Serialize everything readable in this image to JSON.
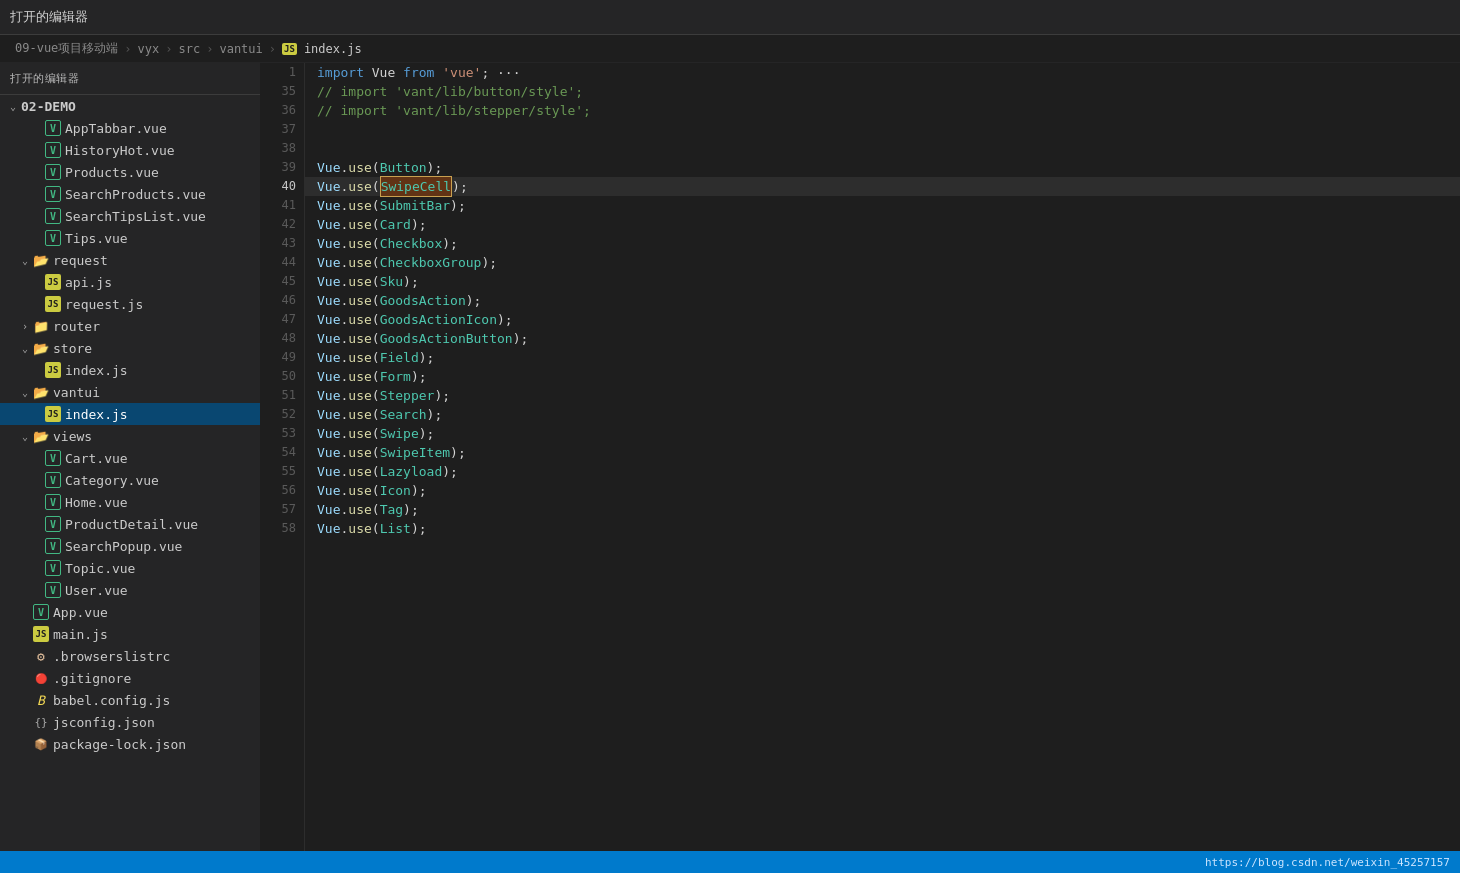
{
  "topbar": {
    "label": "打开的编辑器"
  },
  "breadcrumb": {
    "parts": [
      "09-vue项目移动端",
      "vyx",
      "src",
      "vantui",
      "index.js"
    ],
    "separator": "›"
  },
  "sidebar": {
    "header": "打开的编辑器",
    "section_label": "02-DEMO",
    "items": [
      {
        "id": "AppTabbar",
        "label": "AppTabbar.vue",
        "type": "vue",
        "indent": 2
      },
      {
        "id": "HistoryHot",
        "label": "HistoryHot.vue",
        "type": "vue",
        "indent": 2
      },
      {
        "id": "Products",
        "label": "Products.vue",
        "type": "vue",
        "indent": 2
      },
      {
        "id": "SearchProducts",
        "label": "SearchProducts.vue",
        "type": "vue",
        "indent": 2
      },
      {
        "id": "SearchTipsList",
        "label": "SearchTipsList.vue",
        "type": "vue",
        "indent": 2
      },
      {
        "id": "Tips",
        "label": "Tips.vue",
        "type": "vue",
        "indent": 2
      },
      {
        "id": "request",
        "label": "request",
        "type": "folder",
        "indent": 1,
        "open": true
      },
      {
        "id": "api",
        "label": "api.js",
        "type": "js",
        "indent": 2
      },
      {
        "id": "request_js",
        "label": "request.js",
        "type": "js",
        "indent": 2
      },
      {
        "id": "router",
        "label": "router",
        "type": "folder",
        "indent": 1,
        "open": false
      },
      {
        "id": "store",
        "label": "store",
        "type": "folder",
        "indent": 1,
        "open": true
      },
      {
        "id": "store_index",
        "label": "index.js",
        "type": "js",
        "indent": 2
      },
      {
        "id": "vantui",
        "label": "vantui",
        "type": "folder",
        "indent": 1,
        "open": true
      },
      {
        "id": "index_js",
        "label": "index.js",
        "type": "js",
        "indent": 2,
        "active": true
      },
      {
        "id": "views",
        "label": "views",
        "type": "folder",
        "indent": 1,
        "open": true
      },
      {
        "id": "Cart",
        "label": "Cart.vue",
        "type": "vue",
        "indent": 2
      },
      {
        "id": "Category",
        "label": "Category.vue",
        "type": "vue",
        "indent": 2
      },
      {
        "id": "Home",
        "label": "Home.vue",
        "type": "vue",
        "indent": 2
      },
      {
        "id": "ProductDetail",
        "label": "ProductDetail.vue",
        "type": "vue",
        "indent": 2
      },
      {
        "id": "SearchPopup",
        "label": "SearchPopup.vue",
        "type": "vue",
        "indent": 2
      },
      {
        "id": "Topic",
        "label": "Topic.vue",
        "type": "vue",
        "indent": 2
      },
      {
        "id": "User",
        "label": "User.vue",
        "type": "vue",
        "indent": 2
      },
      {
        "id": "App",
        "label": "App.vue",
        "type": "vue",
        "indent": 1
      },
      {
        "id": "main_js",
        "label": "main.js",
        "type": "js",
        "indent": 1
      },
      {
        "id": "browserslistrc",
        "label": ".browserslistrc",
        "type": "browserslistrc",
        "indent": 1
      },
      {
        "id": "gitignore",
        "label": ".gitignore",
        "type": "gitignore",
        "indent": 1
      },
      {
        "id": "babel_config",
        "label": "babel.config.js",
        "type": "babel",
        "indent": 1
      },
      {
        "id": "jsconfig",
        "label": "jsconfig.json",
        "type": "json",
        "indent": 1
      },
      {
        "id": "package_lock",
        "label": "package-lock.json",
        "type": "package",
        "indent": 1
      }
    ]
  },
  "editor": {
    "filename": "index.js",
    "lines": [
      {
        "num": 1,
        "content": "import Vue from 'vue'; ···",
        "tokens": [
          {
            "t": "kw",
            "v": "import"
          },
          {
            "t": "plain",
            "v": " "
          },
          {
            "t": "plain",
            "v": "Vue"
          },
          {
            "t": "plain",
            "v": " "
          },
          {
            "t": "kw",
            "v": "from"
          },
          {
            "t": "plain",
            "v": " "
          },
          {
            "t": "str",
            "v": "'vue'"
          },
          {
            "t": "plain",
            "v": "; ···"
          }
        ]
      },
      {
        "num": 35,
        "content": "// import 'vant/lib/button/style';",
        "tokens": [
          {
            "t": "comment",
            "v": "// import 'vant/lib/button/style';"
          }
        ]
      },
      {
        "num": 36,
        "content": "// import 'vant/lib/stepper/style';",
        "tokens": [
          {
            "t": "comment",
            "v": "// import 'vant/lib/stepper/style';"
          }
        ]
      },
      {
        "num": 37,
        "content": "",
        "tokens": []
      },
      {
        "num": 38,
        "content": "",
        "tokens": []
      },
      {
        "num": 39,
        "content": "Vue.use(Button);",
        "tokens": [
          {
            "t": "obj",
            "v": "Vue"
          },
          {
            "t": "plain",
            "v": "."
          },
          {
            "t": "fn",
            "v": "use"
          },
          {
            "t": "plain",
            "v": "("
          },
          {
            "t": "cls",
            "v": "Button"
          },
          {
            "t": "plain",
            "v": ");"
          }
        ]
      },
      {
        "num": 40,
        "content": "Vue.use(SwipeCell);",
        "tokens": [
          {
            "t": "obj",
            "v": "Vue"
          },
          {
            "t": "plain",
            "v": "."
          },
          {
            "t": "fn",
            "v": "use"
          },
          {
            "t": "plain",
            "v": "("
          },
          {
            "t": "cls",
            "v": "SwipeCell",
            "selected": true
          },
          {
            "t": "plain",
            "v": ");"
          }
        ],
        "cursor": true
      },
      {
        "num": 41,
        "content": "Vue.use(SubmitBar);",
        "tokens": [
          {
            "t": "obj",
            "v": "Vue"
          },
          {
            "t": "plain",
            "v": "."
          },
          {
            "t": "fn",
            "v": "use"
          },
          {
            "t": "plain",
            "v": "("
          },
          {
            "t": "cls",
            "v": "SubmitBar"
          },
          {
            "t": "plain",
            "v": ");"
          }
        ]
      },
      {
        "num": 42,
        "content": "Vue.use(Card);",
        "tokens": [
          {
            "t": "obj",
            "v": "Vue"
          },
          {
            "t": "plain",
            "v": "."
          },
          {
            "t": "fn",
            "v": "use"
          },
          {
            "t": "plain",
            "v": "("
          },
          {
            "t": "cls",
            "v": "Card"
          },
          {
            "t": "plain",
            "v": ");"
          }
        ]
      },
      {
        "num": 43,
        "content": "Vue.use(Checkbox);",
        "tokens": [
          {
            "t": "obj",
            "v": "Vue"
          },
          {
            "t": "plain",
            "v": "."
          },
          {
            "t": "fn",
            "v": "use"
          },
          {
            "t": "plain",
            "v": "("
          },
          {
            "t": "cls",
            "v": "Checkbox"
          },
          {
            "t": "plain",
            "v": ");"
          }
        ]
      },
      {
        "num": 44,
        "content": "Vue.use(CheckboxGroup);",
        "tokens": [
          {
            "t": "obj",
            "v": "Vue"
          },
          {
            "t": "plain",
            "v": "."
          },
          {
            "t": "fn",
            "v": "use"
          },
          {
            "t": "plain",
            "v": "("
          },
          {
            "t": "cls",
            "v": "CheckboxGroup"
          },
          {
            "t": "plain",
            "v": ");"
          }
        ]
      },
      {
        "num": 45,
        "content": "Vue.use(Sku);",
        "tokens": [
          {
            "t": "obj",
            "v": "Vue"
          },
          {
            "t": "plain",
            "v": "."
          },
          {
            "t": "fn",
            "v": "use"
          },
          {
            "t": "plain",
            "v": "("
          },
          {
            "t": "cls",
            "v": "Sku"
          },
          {
            "t": "plain",
            "v": ");"
          }
        ]
      },
      {
        "num": 46,
        "content": "Vue.use(GoodsAction);",
        "tokens": [
          {
            "t": "obj",
            "v": "Vue"
          },
          {
            "t": "plain",
            "v": "."
          },
          {
            "t": "fn",
            "v": "use"
          },
          {
            "t": "plain",
            "v": "("
          },
          {
            "t": "cls",
            "v": "GoodsAction"
          },
          {
            "t": "plain",
            "v": ");"
          }
        ]
      },
      {
        "num": 47,
        "content": "Vue.use(GoodsActionIcon);",
        "tokens": [
          {
            "t": "obj",
            "v": "Vue"
          },
          {
            "t": "plain",
            "v": "."
          },
          {
            "t": "fn",
            "v": "use"
          },
          {
            "t": "plain",
            "v": "("
          },
          {
            "t": "cls",
            "v": "GoodsActionIcon"
          },
          {
            "t": "plain",
            "v": ");"
          }
        ]
      },
      {
        "num": 48,
        "content": "Vue.use(GoodsActionButton);",
        "tokens": [
          {
            "t": "obj",
            "v": "Vue"
          },
          {
            "t": "plain",
            "v": "."
          },
          {
            "t": "fn",
            "v": "use"
          },
          {
            "t": "plain",
            "v": "("
          },
          {
            "t": "cls",
            "v": "GoodsActionButton"
          },
          {
            "t": "plain",
            "v": ");"
          }
        ]
      },
      {
        "num": 49,
        "content": "Vue.use(Field);",
        "tokens": [
          {
            "t": "obj",
            "v": "Vue"
          },
          {
            "t": "plain",
            "v": "."
          },
          {
            "t": "fn",
            "v": "use"
          },
          {
            "t": "plain",
            "v": "("
          },
          {
            "t": "cls",
            "v": "Field"
          },
          {
            "t": "plain",
            "v": ");"
          }
        ]
      },
      {
        "num": 50,
        "content": "Vue.use(Form);",
        "tokens": [
          {
            "t": "obj",
            "v": "Vue"
          },
          {
            "t": "plain",
            "v": "."
          },
          {
            "t": "fn",
            "v": "use"
          },
          {
            "t": "plain",
            "v": "("
          },
          {
            "t": "cls",
            "v": "Form"
          },
          {
            "t": "plain",
            "v": ");"
          }
        ]
      },
      {
        "num": 51,
        "content": "Vue.use(Stepper);",
        "tokens": [
          {
            "t": "obj",
            "v": "Vue"
          },
          {
            "t": "plain",
            "v": "."
          },
          {
            "t": "fn",
            "v": "use"
          },
          {
            "t": "plain",
            "v": "("
          },
          {
            "t": "cls",
            "v": "Stepper"
          },
          {
            "t": "plain",
            "v": ");"
          }
        ]
      },
      {
        "num": 52,
        "content": "Vue.use(Search);",
        "tokens": [
          {
            "t": "obj",
            "v": "Vue"
          },
          {
            "t": "plain",
            "v": "."
          },
          {
            "t": "fn",
            "v": "use"
          },
          {
            "t": "plain",
            "v": "("
          },
          {
            "t": "cls",
            "v": "Search"
          },
          {
            "t": "plain",
            "v": ");"
          }
        ]
      },
      {
        "num": 53,
        "content": "Vue.use(Swipe);",
        "tokens": [
          {
            "t": "obj",
            "v": "Vue"
          },
          {
            "t": "plain",
            "v": "."
          },
          {
            "t": "fn",
            "v": "use"
          },
          {
            "t": "plain",
            "v": "("
          },
          {
            "t": "cls",
            "v": "Swipe"
          },
          {
            "t": "plain",
            "v": ");"
          }
        ]
      },
      {
        "num": 54,
        "content": "Vue.use(SwipeItem);",
        "tokens": [
          {
            "t": "obj",
            "v": "Vue"
          },
          {
            "t": "plain",
            "v": "."
          },
          {
            "t": "fn",
            "v": "use"
          },
          {
            "t": "plain",
            "v": "("
          },
          {
            "t": "cls",
            "v": "SwipeItem"
          },
          {
            "t": "plain",
            "v": ");"
          }
        ]
      },
      {
        "num": 55,
        "content": "Vue.use(Lazyload);",
        "tokens": [
          {
            "t": "obj",
            "v": "Vue"
          },
          {
            "t": "plain",
            "v": "."
          },
          {
            "t": "fn",
            "v": "use"
          },
          {
            "t": "plain",
            "v": "("
          },
          {
            "t": "cls",
            "v": "Lazyload"
          },
          {
            "t": "plain",
            "v": ");"
          }
        ]
      },
      {
        "num": 56,
        "content": "Vue.use(Icon);",
        "tokens": [
          {
            "t": "obj",
            "v": "Vue"
          },
          {
            "t": "plain",
            "v": "."
          },
          {
            "t": "fn",
            "v": "use"
          },
          {
            "t": "plain",
            "v": "("
          },
          {
            "t": "cls",
            "v": "Icon"
          },
          {
            "t": "plain",
            "v": ");"
          }
        ]
      },
      {
        "num": 57,
        "content": "Vue.use(Tag);",
        "tokens": [
          {
            "t": "obj",
            "v": "Vue"
          },
          {
            "t": "plain",
            "v": "."
          },
          {
            "t": "fn",
            "v": "use"
          },
          {
            "t": "plain",
            "v": "("
          },
          {
            "t": "cls",
            "v": "Tag"
          },
          {
            "t": "plain",
            "v": ");"
          }
        ]
      },
      {
        "num": 58,
        "content": "Vue.use(List);",
        "tokens": [
          {
            "t": "obj",
            "v": "Vue"
          },
          {
            "t": "plain",
            "v": "."
          },
          {
            "t": "fn",
            "v": "use"
          },
          {
            "t": "plain",
            "v": "("
          },
          {
            "t": "cls",
            "v": "List"
          },
          {
            "t": "plain",
            "v": ");"
          }
        ]
      }
    ]
  },
  "statusbar": {
    "url": "https://blog.csdn.net/weixin_45257157"
  }
}
